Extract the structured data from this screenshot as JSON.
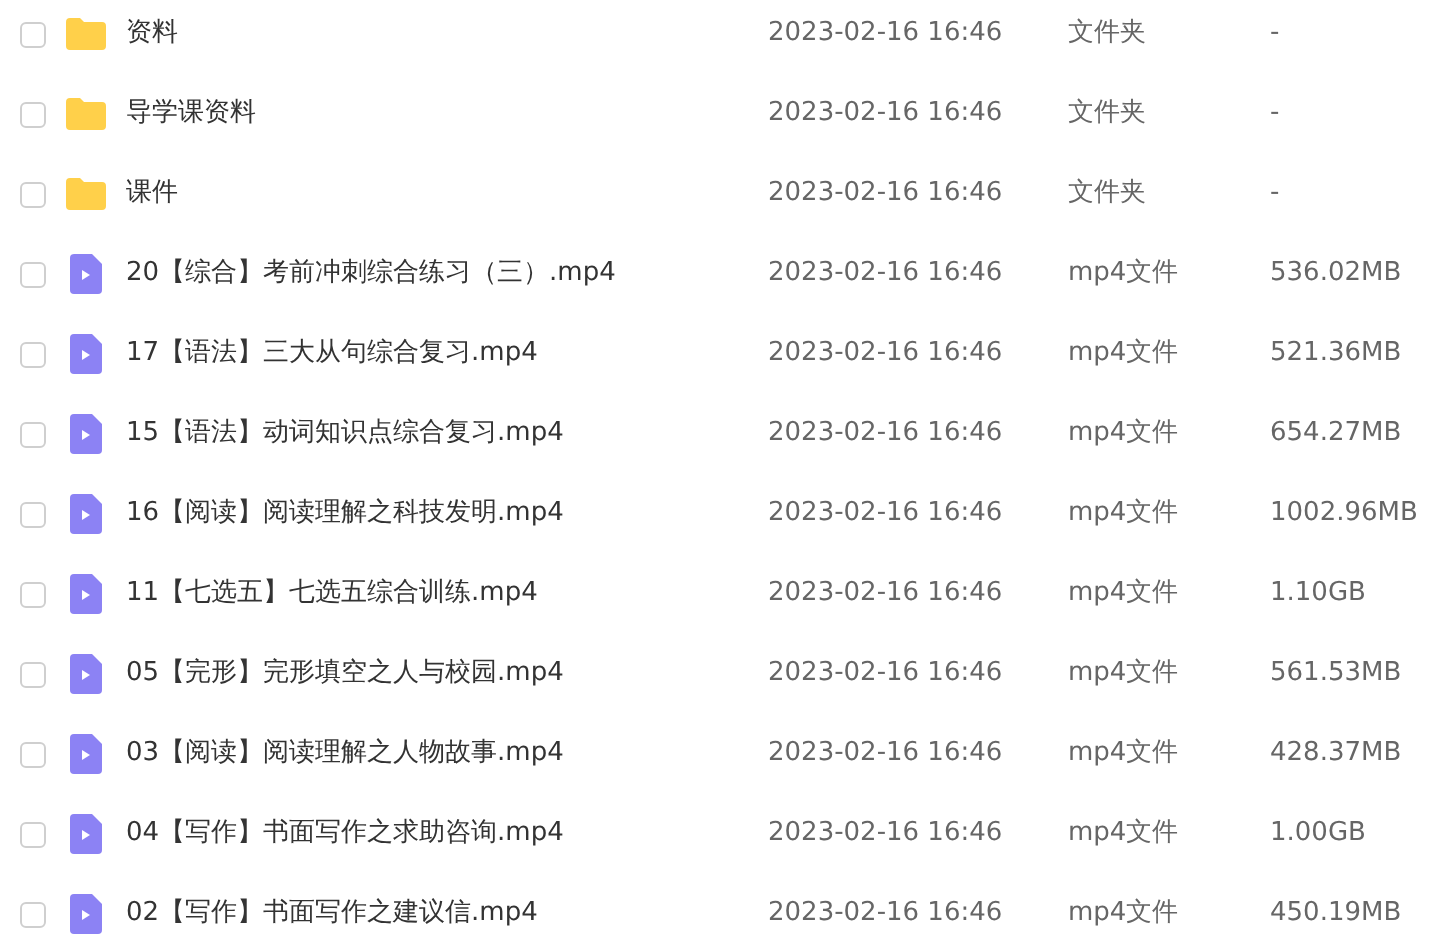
{
  "files": [
    {
      "kind": "folder",
      "checked": false,
      "name": "资料",
      "date": "2023-02-16 16:46",
      "type": "文件夹",
      "size": "-"
    },
    {
      "kind": "folder",
      "checked": false,
      "name": "导学课资料",
      "date": "2023-02-16 16:46",
      "type": "文件夹",
      "size": "-"
    },
    {
      "kind": "folder",
      "checked": false,
      "name": "课件",
      "date": "2023-02-16 16:46",
      "type": "文件夹",
      "size": "-"
    },
    {
      "kind": "video",
      "checked": false,
      "name": "20【综合】考前冲刺综合练习（三）.mp4",
      "date": "2023-02-16 16:46",
      "type": "mp4文件",
      "size": "536.02MB"
    },
    {
      "kind": "video",
      "checked": false,
      "name": "17【语法】三大从句综合复习.mp4",
      "date": "2023-02-16 16:46",
      "type": "mp4文件",
      "size": "521.36MB"
    },
    {
      "kind": "video",
      "checked": false,
      "name": "15【语法】动词知识点综合复习.mp4",
      "date": "2023-02-16 16:46",
      "type": "mp4文件",
      "size": "654.27MB"
    },
    {
      "kind": "video",
      "checked": false,
      "name": "16【阅读】阅读理解之科技发明.mp4",
      "date": "2023-02-16 16:46",
      "type": "mp4文件",
      "size": "1002.96MB"
    },
    {
      "kind": "video",
      "checked": false,
      "name": "11【七选五】七选五综合训练.mp4",
      "date": "2023-02-16 16:46",
      "type": "mp4文件",
      "size": "1.10GB"
    },
    {
      "kind": "video",
      "checked": false,
      "name": "05【完形】完形填空之人与校园.mp4",
      "date": "2023-02-16 16:46",
      "type": "mp4文件",
      "size": "561.53MB"
    },
    {
      "kind": "video",
      "checked": false,
      "name": "03【阅读】阅读理解之人物故事.mp4",
      "date": "2023-02-16 16:46",
      "type": "mp4文件",
      "size": "428.37MB"
    },
    {
      "kind": "video",
      "checked": false,
      "name": "04【写作】书面写作之求助咨询.mp4",
      "date": "2023-02-16 16:46",
      "type": "mp4文件",
      "size": "1.00GB"
    },
    {
      "kind": "video",
      "checked": false,
      "name": "02【写作】书面写作之建议信.mp4",
      "date": "2023-02-16 16:46",
      "type": "mp4文件",
      "size": "450.19MB"
    }
  ]
}
